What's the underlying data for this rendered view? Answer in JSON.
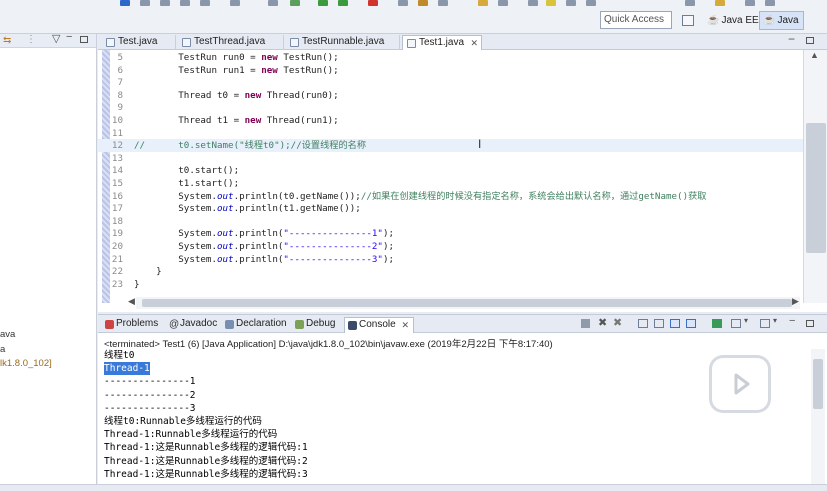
{
  "toolbar": {
    "quick_access_label": "Quick Access",
    "perspectives": [
      {
        "label": "Java EE"
      },
      {
        "label": "Java"
      }
    ]
  },
  "left_pane": {
    "items": [
      "ava",
      "a",
      "lk1.8.0_102]"
    ]
  },
  "editor": {
    "tabs": [
      {
        "label": "Test.java"
      },
      {
        "label": "TestThread.java"
      },
      {
        "label": "TestRunnable.java"
      },
      {
        "label": "Test1.java"
      }
    ],
    "lines": [
      {
        "num": "5",
        "text": "        TestRun run0 = new TestRun();"
      },
      {
        "num": "6",
        "text": "        TestRun run1 = new TestRun();"
      },
      {
        "num": "7",
        "text": ""
      },
      {
        "num": "8",
        "text": "        Thread t0 = new Thread(run0);"
      },
      {
        "num": "9",
        "text": ""
      },
      {
        "num": "10",
        "text": "        Thread t1 = new Thread(run1);"
      },
      {
        "num": "11",
        "text": ""
      },
      {
        "num": "12",
        "text": "//      t0.setName(\"线程t0\");//设置线程的名称"
      },
      {
        "num": "13",
        "text": ""
      },
      {
        "num": "14",
        "text": "        t0.start();"
      },
      {
        "num": "15",
        "text": "        t1.start();"
      },
      {
        "num": "16",
        "text": "        System.out.println(t0.getName());//如果在创建线程的时候没有指定名称，系统会给出默认名称，通过getName()获取"
      },
      {
        "num": "17",
        "text": "        System.out.println(t1.getName());"
      },
      {
        "num": "18",
        "text": ""
      },
      {
        "num": "19",
        "text": "        System.out.println(\"---------------1\");"
      },
      {
        "num": "20",
        "text": "        System.out.println(\"---------------2\");"
      },
      {
        "num": "21",
        "text": "        System.out.println(\"---------------3\");"
      },
      {
        "num": "22",
        "text": "    }"
      },
      {
        "num": "23",
        "text": "}"
      }
    ]
  },
  "console": {
    "tabs": [
      {
        "label": "Problems"
      },
      {
        "label": "Javadoc"
      },
      {
        "label": "Declaration"
      },
      {
        "label": "Debug"
      },
      {
        "label": "Console"
      }
    ],
    "status": "<terminated> Test1 (6) [Java Application] D:\\java\\jdk1.8.0_102\\bin\\javaw.exe (2019年2月22日 下午8:17:40)",
    "output": [
      "线程t0",
      "Thread-1",
      "---------------1",
      "---------------2",
      "---------------3",
      "线程t0:Runnable多线程运行的代码",
      "Thread-1:Runnable多线程运行的代码",
      "Thread-1:这是Runnable多线程的逻辑代码:1",
      "Thread-1:这是Runnable多线程的逻辑代码:2",
      "Thread-1:这是Runnable多线程的逻辑代码:3"
    ]
  },
  "colors": {
    "keyword": "#7f0055",
    "comment": "#3f7f5f",
    "string": "#2a00ff",
    "selection": "#3879d9"
  }
}
